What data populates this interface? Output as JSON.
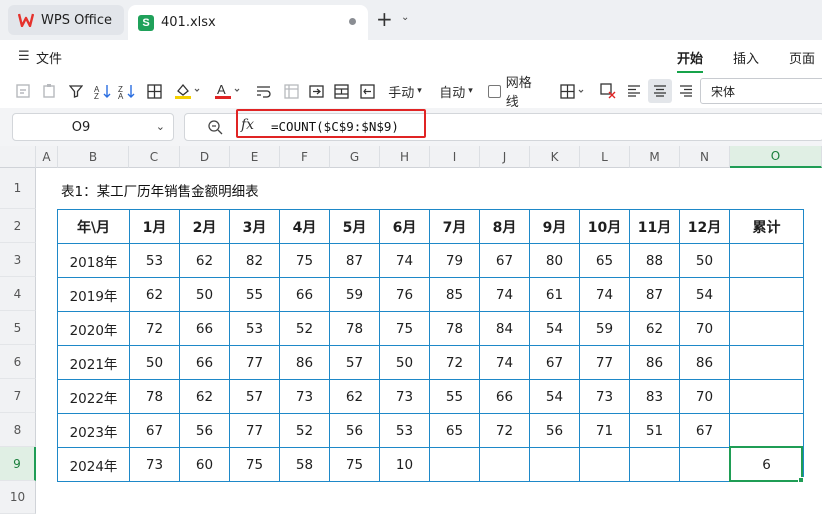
{
  "titlebar": {
    "home_tab_label": "WPS Office",
    "file_tab_label": "401.xlsx",
    "new_tab_symbol": "+",
    "tab_more_symbol": "⌄"
  },
  "menu": {
    "file_label": "文件",
    "ribbon_tabs": [
      "开始",
      "插入",
      "页面"
    ],
    "active_tab": "开始"
  },
  "toolbar": {
    "manual_label": "手动",
    "auto_label": "自动",
    "gridlines_label": "网格线",
    "gridlines_checked": false,
    "font_name": "宋体",
    "accent_color": "#1f9d55"
  },
  "formula_bar": {
    "name_box": "O9",
    "fx_symbol": "fx",
    "formula": "=COUNT($C$9:$N$9)"
  },
  "grid": {
    "columns": [
      "A",
      "B",
      "C",
      "D",
      "E",
      "F",
      "G",
      "H",
      "I",
      "J",
      "K",
      "L",
      "M",
      "N",
      "O"
    ],
    "rows": [
      "1",
      "2",
      "3",
      "4",
      "5",
      "6",
      "7",
      "8",
      "9",
      "10"
    ],
    "selected_column": "O",
    "selected_row": "9"
  },
  "sheet": {
    "title": "表1：某工厂历年销售金额明细表",
    "headers": [
      "年\\月",
      "1月",
      "2月",
      "3月",
      "4月",
      "5月",
      "6月",
      "7月",
      "8月",
      "9月",
      "10月",
      "11月",
      "12月",
      "累计"
    ],
    "rows": [
      [
        "2018年",
        "53",
        "62",
        "82",
        "75",
        "87",
        "74",
        "79",
        "67",
        "80",
        "65",
        "88",
        "50",
        ""
      ],
      [
        "2019年",
        "62",
        "50",
        "55",
        "66",
        "59",
        "76",
        "85",
        "74",
        "61",
        "74",
        "87",
        "54",
        ""
      ],
      [
        "2020年",
        "72",
        "66",
        "53",
        "52",
        "78",
        "75",
        "78",
        "84",
        "54",
        "59",
        "62",
        "70",
        ""
      ],
      [
        "2021年",
        "50",
        "66",
        "77",
        "86",
        "57",
        "50",
        "72",
        "74",
        "67",
        "77",
        "86",
        "86",
        ""
      ],
      [
        "2022年",
        "78",
        "62",
        "57",
        "73",
        "62",
        "73",
        "55",
        "66",
        "54",
        "73",
        "83",
        "70",
        ""
      ],
      [
        "2023年",
        "67",
        "56",
        "77",
        "52",
        "56",
        "53",
        "65",
        "72",
        "56",
        "71",
        "51",
        "67",
        ""
      ],
      [
        "2024年",
        "73",
        "60",
        "75",
        "58",
        "75",
        "10",
        "",
        "",
        "",
        "",
        "",
        "",
        "6"
      ]
    ]
  }
}
